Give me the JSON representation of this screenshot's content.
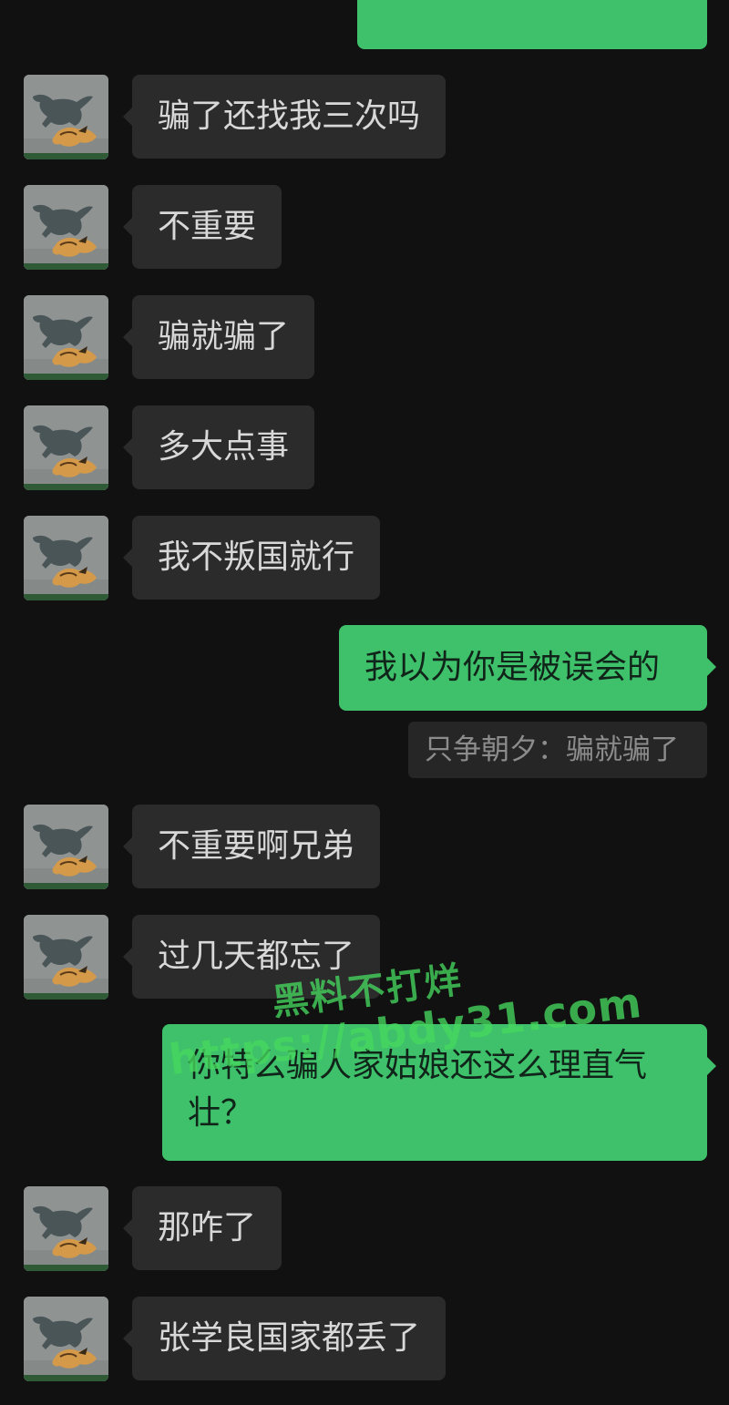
{
  "colors": {
    "background": "#111111",
    "incoming_bubble": "#2b2b2b",
    "outgoing_bubble": "#3ec16a",
    "quote_bubble": "#262626",
    "watermark": "#46d75f"
  },
  "contact": {
    "avatar_icon": "horse-painting-avatar-icon"
  },
  "messages": [
    {
      "sender": "contact",
      "text": "骗了还找我三次吗"
    },
    {
      "sender": "contact",
      "text": "不重要"
    },
    {
      "sender": "contact",
      "text": "骗就骗了"
    },
    {
      "sender": "contact",
      "text": "多大点事"
    },
    {
      "sender": "contact",
      "text": "我不叛国就行"
    },
    {
      "sender": "me",
      "text": "我以为你是被误会的"
    },
    {
      "sender": "quote",
      "text": "只争朝夕：骗就骗了"
    },
    {
      "sender": "contact",
      "text": "不重要啊兄弟"
    },
    {
      "sender": "contact",
      "text": "过几天都忘了"
    },
    {
      "sender": "me",
      "text": "你特么骗人家姑娘还这么理直气壮？"
    },
    {
      "sender": "contact",
      "text": "那咋了"
    },
    {
      "sender": "contact",
      "text": "张学良国家都丢了"
    }
  ],
  "watermark": {
    "line1": "黑料不打烊",
    "line2": "https://abdy31.com"
  }
}
